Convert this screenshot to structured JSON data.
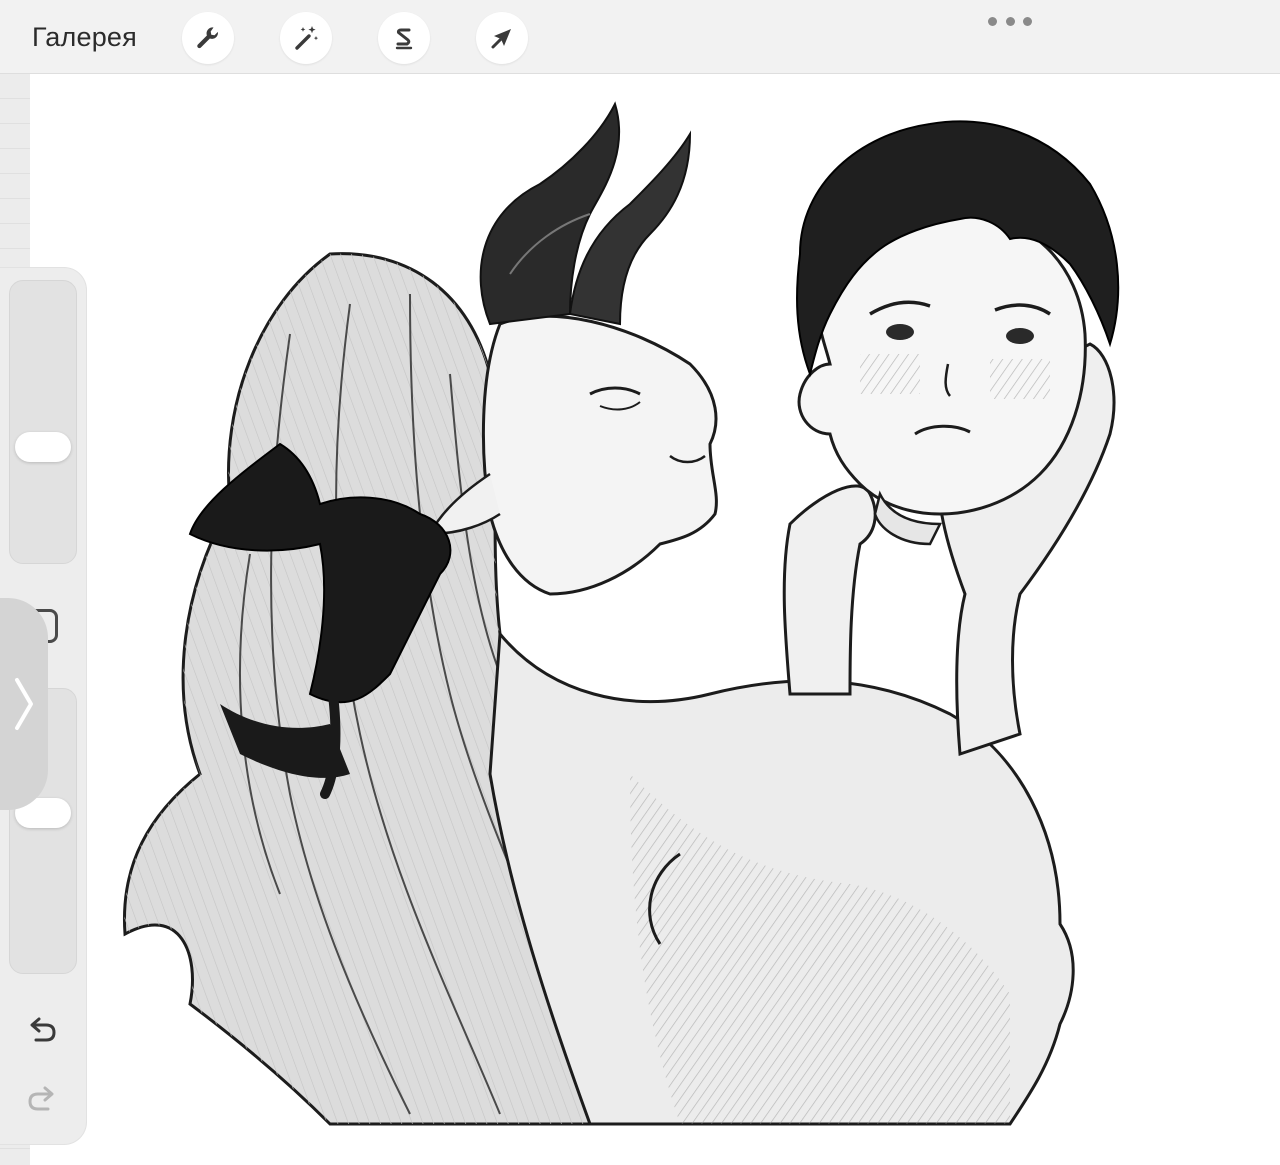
{
  "topbar": {
    "gallery_label": "Галерея",
    "tools": [
      "wrench-icon",
      "magic-wand-icon",
      "selection-s-icon",
      "transform-arrow-icon"
    ],
    "more_icon": "ellipsis-icon"
  },
  "sidebar": {
    "brush_size_slider_level": 0.55,
    "opacity_slider_level": 0.55,
    "modify_button_icon": "square-icon",
    "collapse_icon": "chevron-right-icon",
    "undo_icon": "undo-arrow-icon",
    "redo_icon": "redo-arrow-icon"
  },
  "canvas": {
    "artwork": "grayscale-illustration"
  }
}
